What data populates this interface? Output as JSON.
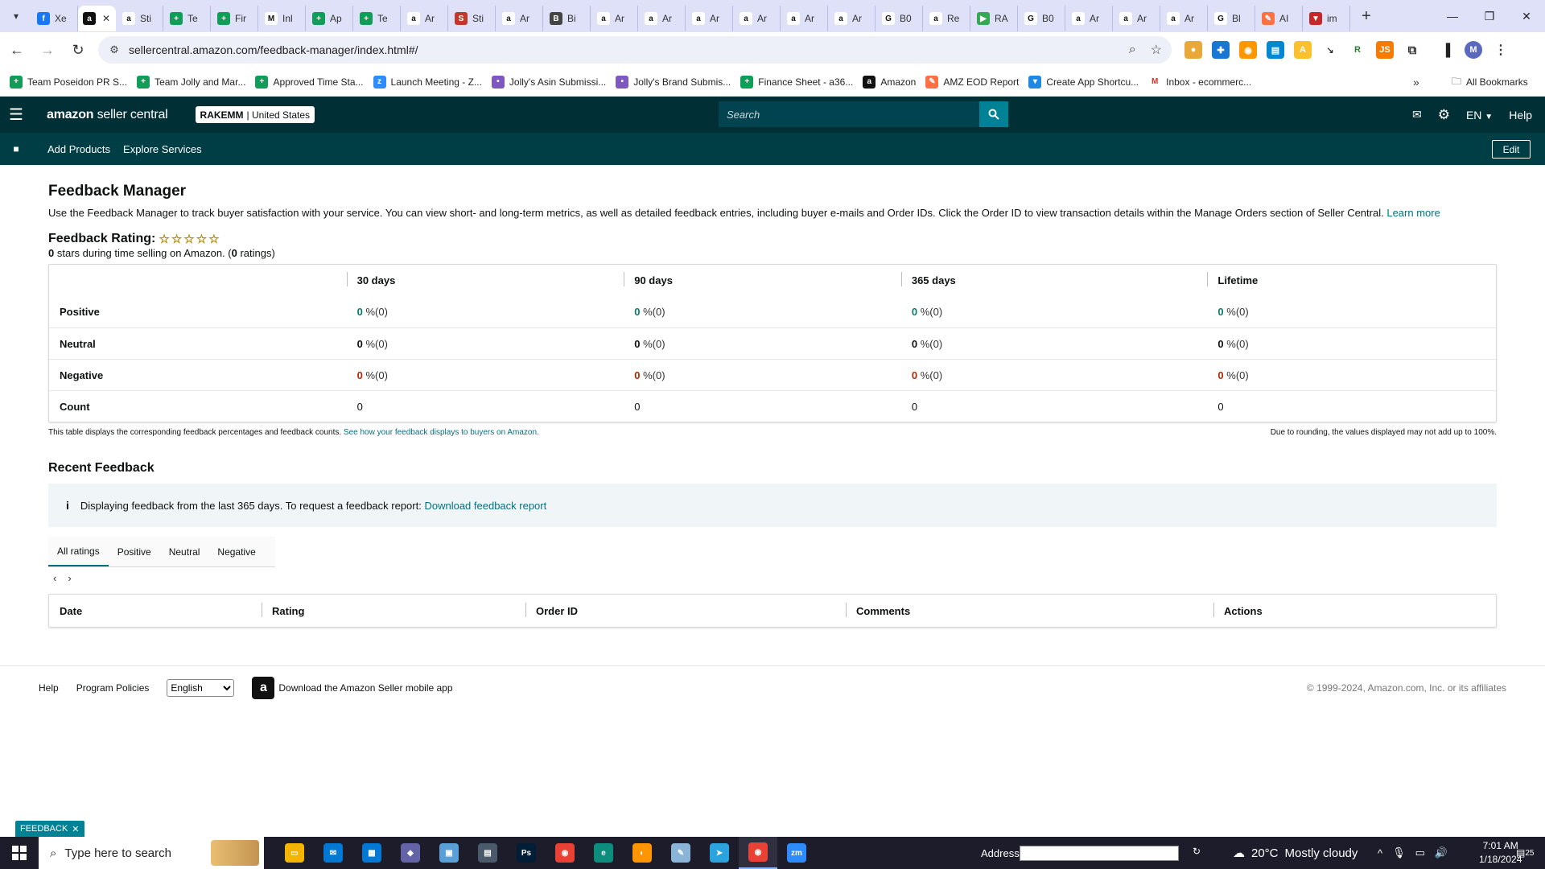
{
  "browser": {
    "tabs": [
      {
        "title": "Xe",
        "icon": "facebook-icon",
        "color": "#1877f2",
        "glyph": "f"
      },
      {
        "title": "",
        "icon": "amazon-icon",
        "color": "#111111",
        "glyph": "a",
        "active": true
      },
      {
        "title": "Sti",
        "icon": "amazon-icon",
        "color": "#ffffff",
        "glyph": "a"
      },
      {
        "title": "Te",
        "icon": "sheets-icon",
        "color": "#0f9d58",
        "glyph": "+"
      },
      {
        "title": "Fir",
        "icon": "sheets-icon",
        "color": "#0f9d58",
        "glyph": "+"
      },
      {
        "title": "Inl",
        "icon": "gmail-icon",
        "color": "#ffffff",
        "glyph": "M"
      },
      {
        "title": "Ap",
        "icon": "sheets-icon",
        "color": "#0f9d58",
        "glyph": "+"
      },
      {
        "title": "Te",
        "icon": "sheets-icon",
        "color": "#0f9d58",
        "glyph": "+"
      },
      {
        "title": "Ar",
        "icon": "amazon-icon",
        "color": "#ffffff",
        "glyph": "a"
      },
      {
        "title": "Sti",
        "icon": "shield-icon",
        "color": "#c0392b",
        "glyph": "S"
      },
      {
        "title": "Ar",
        "icon": "amazon-icon",
        "color": "#ffffff",
        "glyph": "a"
      },
      {
        "title": "Bi",
        "icon": "eye-icon",
        "color": "#444444",
        "glyph": "B"
      },
      {
        "title": "Ar",
        "icon": "amazon-icon",
        "color": "#ffffff",
        "glyph": "a"
      },
      {
        "title": "Ar",
        "icon": "amazon-icon",
        "color": "#ffffff",
        "glyph": "a"
      },
      {
        "title": "Ar",
        "icon": "amazon-icon",
        "color": "#ffffff",
        "glyph": "a"
      },
      {
        "title": "Ar",
        "icon": "amazon-icon",
        "color": "#ffffff",
        "glyph": "a"
      },
      {
        "title": "Ar",
        "icon": "amazon-icon",
        "color": "#ffffff",
        "glyph": "a"
      },
      {
        "title": "Ar",
        "icon": "amazon-icon",
        "color": "#ffffff",
        "glyph": "a"
      },
      {
        "title": "B0",
        "icon": "google-icon",
        "color": "#ffffff",
        "glyph": "G"
      },
      {
        "title": "Re",
        "icon": "amazon-icon",
        "color": "#ffffff",
        "glyph": "a"
      },
      {
        "title": "RA",
        "icon": "play-icon",
        "color": "#34a853",
        "glyph": "▶"
      },
      {
        "title": "B0",
        "icon": "google-icon",
        "color": "#ffffff",
        "glyph": "G"
      },
      {
        "title": "Ar",
        "icon": "amazon-icon",
        "color": "#ffffff",
        "glyph": "a"
      },
      {
        "title": "Ar",
        "icon": "amazon-icon",
        "color": "#ffffff",
        "glyph": "a"
      },
      {
        "title": "Ar",
        "icon": "amazon-icon",
        "color": "#ffffff",
        "glyph": "a"
      },
      {
        "title": "Bl",
        "icon": "google-icon",
        "color": "#ffffff",
        "glyph": "G"
      },
      {
        "title": "AI",
        "icon": "pen-icon",
        "color": "#ff7043",
        "glyph": "✎"
      },
      {
        "title": "im",
        "icon": "vue-icon",
        "color": "#c62828",
        "glyph": "▼"
      }
    ],
    "url": "sellercentral.amazon.com/feedback-manager/index.html#/",
    "profile_initial": "M",
    "bookmarks": [
      {
        "label": "Team Poseidon PR S...",
        "icon": "sheets-icon",
        "color": "#0f9d58",
        "glyph": "+"
      },
      {
        "label": "Team Jolly and Mar...",
        "icon": "sheets-icon",
        "color": "#0f9d58",
        "glyph": "+"
      },
      {
        "label": "Approved Time Sta...",
        "icon": "sheets-icon",
        "color": "#0f9d58",
        "glyph": "+"
      },
      {
        "label": "Launch Meeting - Z...",
        "icon": "zoom-icon",
        "color": "#2d8cff",
        "glyph": "z"
      },
      {
        "label": "Jolly's Asin Submissi...",
        "icon": "form-icon",
        "color": "#7e57c2",
        "glyph": "•"
      },
      {
        "label": "Jolly's Brand Submis...",
        "icon": "form-icon",
        "color": "#7e57c2",
        "glyph": "•"
      },
      {
        "label": "Finance Sheet - a36...",
        "icon": "sheets-icon",
        "color": "#0f9d58",
        "glyph": "+"
      },
      {
        "label": "Amazon",
        "icon": "amazon-icon",
        "color": "#111111",
        "glyph": "a"
      },
      {
        "label": "AMZ EOD Report",
        "icon": "pen-icon",
        "color": "#ff7043",
        "glyph": "✎"
      },
      {
        "label": "Create App Shortcu...",
        "icon": "funnel-icon",
        "color": "#1e88e5",
        "glyph": "▾"
      },
      {
        "label": "Inbox - ecommerc...",
        "icon": "gmail-icon",
        "color": "#ffffff",
        "glyph": "M"
      }
    ],
    "all_bookmarks": "All Bookmarks"
  },
  "sc": {
    "logo_a": "amazon",
    "logo_b": "seller central",
    "store_name": "RAKEMM",
    "store_region": "| United States",
    "search_placeholder": "Search",
    "language": "EN",
    "help": "Help",
    "nav": [
      "Add Products",
      "Explore Services"
    ],
    "edit": "Edit"
  },
  "page": {
    "title": "Feedback Manager",
    "intro": "Use the Feedback Manager to track buyer satisfaction with your service. You can view short- and long-term metrics, as well as detailed feedback entries, including buyer e-mails and Order IDs. Click the Order ID to view transaction details within the Manage Orders section of Seller Central.",
    "learn_more": "Learn more",
    "rating_label": "Feedback Rating:",
    "stars": 0,
    "summary_stars": "0",
    "summary_mid": " stars during time selling on Amazon. (",
    "summary_count": "0",
    "summary_end": " ratings)",
    "metrics": {
      "columns": [
        "30 days",
        "90 days",
        "365 days",
        "Lifetime"
      ],
      "rows": [
        {
          "label": "Positive",
          "cls": "pos",
          "values": [
            "0",
            "0",
            "0",
            "0"
          ],
          "suffix": "%(0)"
        },
        {
          "label": "Neutral",
          "cls": "neu",
          "values": [
            "0",
            "0",
            "0",
            "0"
          ],
          "suffix": "%(0)"
        },
        {
          "label": "Negative",
          "cls": "neg",
          "values": [
            "0",
            "0",
            "0",
            "0"
          ],
          "suffix": "%(0)"
        },
        {
          "label": "Count",
          "cls": "",
          "values": [
            "0",
            "0",
            "0",
            "0"
          ],
          "suffix": ""
        }
      ]
    },
    "table_note": "This table displays the corresponding feedback percentages and feedback counts.",
    "table_note_link": "See how your feedback displays to buyers on Amazon.",
    "rounding_note": "Due to rounding, the values displayed may not add up to 100%.",
    "recent_title": "Recent Feedback",
    "banner_text": "Displaying feedback from the last 365 days. To request a feedback report:",
    "banner_link": "Download feedback report",
    "rating_tabs": [
      "All ratings",
      "Positive",
      "Neutral",
      "Negative"
    ],
    "feedback_columns": [
      "Date",
      "Rating",
      "Order ID",
      "Comments",
      "Actions"
    ]
  },
  "footer": {
    "help": "Help",
    "policies": "Program Policies",
    "language": "English",
    "app_text": "Download the Amazon Seller mobile app",
    "copyright": "© 1999-2024, Amazon.com, Inc. or its affiliates",
    "feedback_chip": "FEEDBACK"
  },
  "taskbar": {
    "search_placeholder": "Type here to search",
    "address_label": "Address",
    "temperature": "20°C",
    "weather": "Mostly cloudy",
    "time": "7:01 AM",
    "date": "1/18/2024",
    "notifications": "25",
    "apps": [
      {
        "name": "file-explorer-icon",
        "color": "#f4b400",
        "glyph": "▭"
      },
      {
        "name": "mail-icon",
        "color": "#0078d4",
        "glyph": "✉"
      },
      {
        "name": "store-icon",
        "color": "#0078d4",
        "glyph": "▦"
      },
      {
        "name": "copilot-icon",
        "color": "#6264a7",
        "glyph": "◆"
      },
      {
        "name": "monitor-icon",
        "color": "#5aa0d8",
        "glyph": "▣"
      },
      {
        "name": "calculator-icon",
        "color": "#4a5a6a",
        "glyph": "▤"
      },
      {
        "name": "photoshop-icon",
        "color": "#001e36",
        "glyph": "Ps"
      },
      {
        "name": "chrome-icon",
        "color": "#e94235",
        "glyph": "◉"
      },
      {
        "name": "edge-icon",
        "color": "#0c8d7e",
        "glyph": "e"
      },
      {
        "name": "firefox-icon",
        "color": "#ff9500",
        "glyph": "◐"
      },
      {
        "name": "notes-icon",
        "color": "#8ab4d8",
        "glyph": "✎"
      },
      {
        "name": "telegram-icon",
        "color": "#2aa3df",
        "glyph": "➤"
      },
      {
        "name": "chrome-profile-icon",
        "color": "#e94235",
        "glyph": "◉",
        "active": true
      },
      {
        "name": "zoom-icon",
        "color": "#2d8cff",
        "glyph": "zm"
      }
    ]
  }
}
